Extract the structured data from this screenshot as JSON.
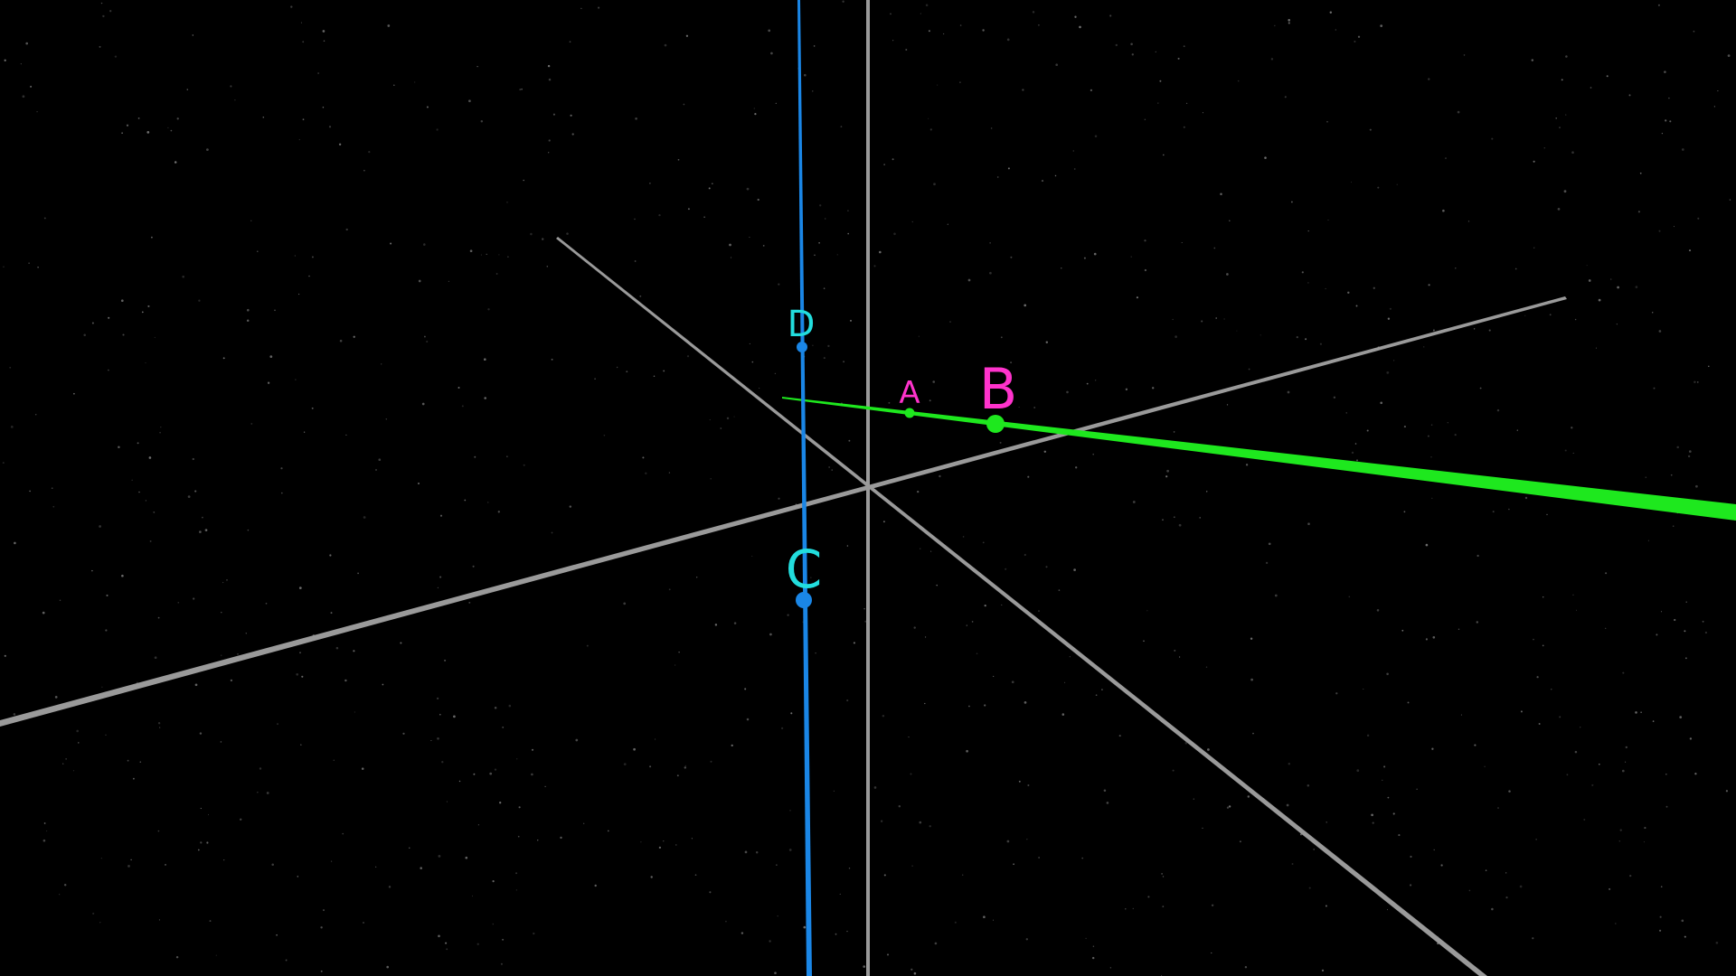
{
  "scene": {
    "background": "#000000",
    "star_color": "#8a8a8a",
    "axis_color": "#9a9a9a"
  },
  "lines": {
    "green": {
      "color": "#1ee81e"
    },
    "blue": {
      "color": "#1a86e6"
    }
  },
  "points": {
    "A": {
      "label": "A",
      "label_color": "#ff33cc",
      "dot_color": "#1ee81e"
    },
    "B": {
      "label": "B",
      "label_color": "#ff33cc",
      "dot_color": "#1ee81e"
    },
    "C": {
      "label": "C",
      "label_color": "#22dddd",
      "dot_color": "#1a86e6"
    },
    "D": {
      "label": "D",
      "label_color": "#22dddd",
      "dot_color": "#1a86e6"
    }
  }
}
